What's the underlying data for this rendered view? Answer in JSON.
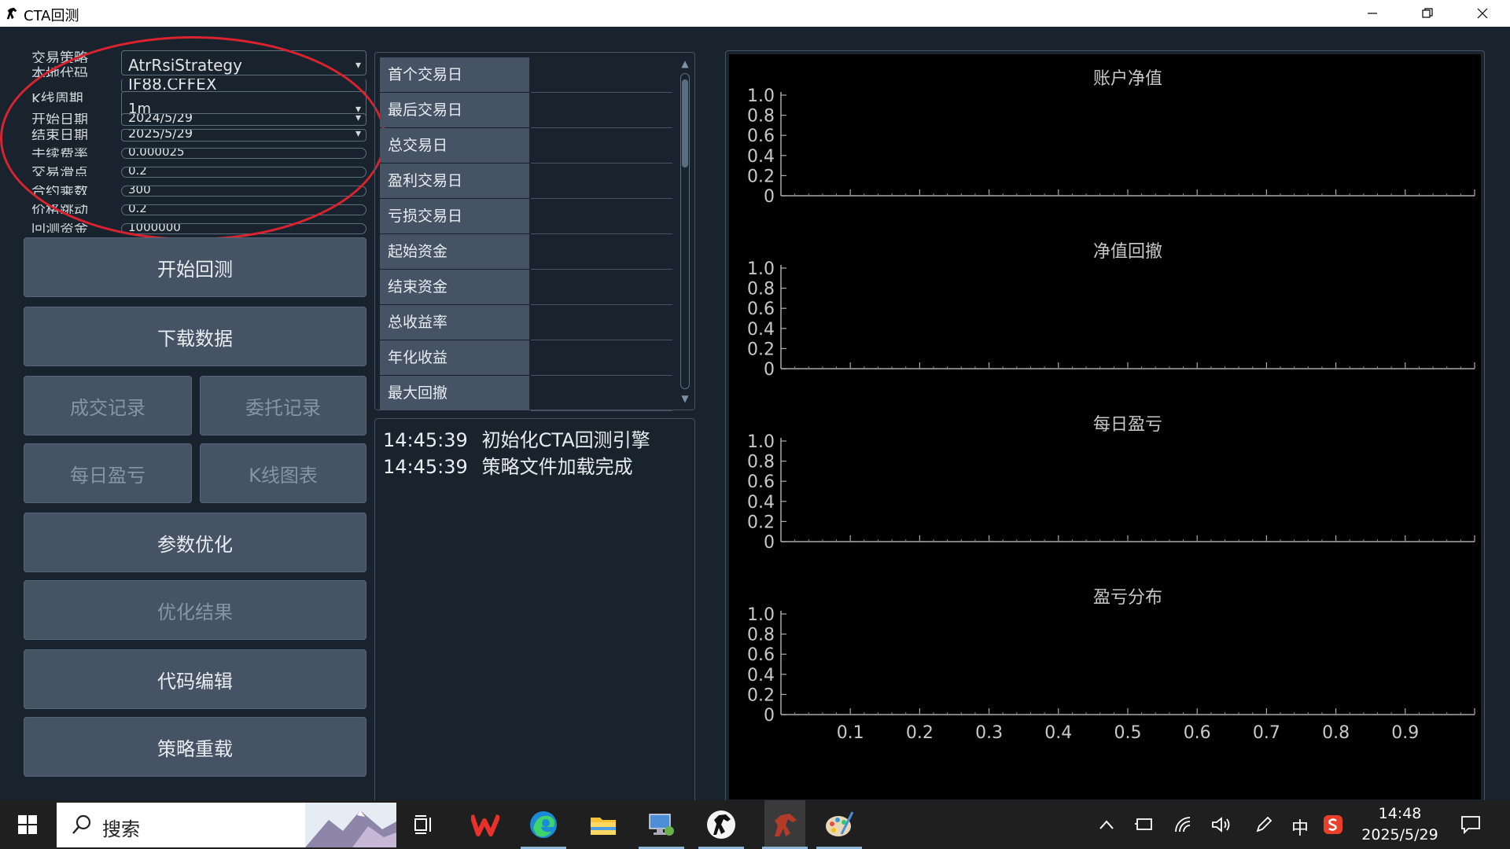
{
  "window": {
    "title": "CTA回测"
  },
  "form": {
    "rows": [
      {
        "label": "交易策略",
        "value": "AtrRsiStrategy",
        "type": "combo"
      },
      {
        "label": "本地代码",
        "value": "IF88.CFFEX",
        "type": "text"
      },
      {
        "label": "K线周期",
        "value": "1m",
        "type": "combo"
      },
      {
        "label": "开始日期",
        "value": "2024/5/29",
        "type": "combo"
      },
      {
        "label": "结束日期",
        "value": "2025/5/29",
        "type": "combo"
      },
      {
        "label": "手续费率",
        "value": "0.000025",
        "type": "text"
      },
      {
        "label": "交易滑点",
        "value": "0.2",
        "type": "text"
      },
      {
        "label": "合约乘数",
        "value": "300",
        "type": "text"
      },
      {
        "label": "价格跳动",
        "value": "0.2",
        "type": "text"
      },
      {
        "label": "回测资金",
        "value": "1000000",
        "type": "text"
      }
    ]
  },
  "buttons": {
    "start_backtest": "开始回测",
    "download_data": "下载数据",
    "trade_records": "成交记录",
    "order_records": "委托记录",
    "daily_pnl": "每日盈亏",
    "kline_chart": "K线图表",
    "param_optimize": "参数优化",
    "optimize_result": "优化结果",
    "code_edit": "代码编辑",
    "strategy_reload": "策略重载"
  },
  "stats": {
    "rows": [
      {
        "label": "首个交易日",
        "value": ""
      },
      {
        "label": "最后交易日",
        "value": ""
      },
      {
        "label": "总交易日",
        "value": ""
      },
      {
        "label": "盈利交易日",
        "value": ""
      },
      {
        "label": "亏损交易日",
        "value": ""
      },
      {
        "label": "起始资金",
        "value": ""
      },
      {
        "label": "结束资金",
        "value": ""
      },
      {
        "label": "总收益率",
        "value": ""
      },
      {
        "label": "年化收益",
        "value": ""
      },
      {
        "label": "最大回撤",
        "value": ""
      }
    ]
  },
  "log": {
    "lines": [
      {
        "time": "14:45:39",
        "msg": "初始化CTA回测引擎"
      },
      {
        "time": "14:45:39",
        "msg": "策略文件加载完成"
      }
    ]
  },
  "chart_data": [
    {
      "type": "line",
      "title": "账户净值",
      "y_ticks": [
        "1.0",
        "0.8",
        "0.6",
        "0.4",
        "0.2",
        "0"
      ],
      "x_ticks": [],
      "series": []
    },
    {
      "type": "line",
      "title": "净值回撤",
      "y_ticks": [
        "1.0",
        "0.8",
        "0.6",
        "0.4",
        "0.2",
        "0"
      ],
      "x_ticks": [],
      "series": []
    },
    {
      "type": "bar",
      "title": "每日盈亏",
      "y_ticks": [
        "1.0",
        "0.8",
        "0.6",
        "0.4",
        "0.2",
        "0"
      ],
      "x_ticks": [],
      "series": []
    },
    {
      "type": "bar",
      "title": "盈亏分布",
      "y_ticks": [
        "1.0",
        "0.8",
        "0.6",
        "0.4",
        "0.2",
        "0"
      ],
      "x_ticks": [
        "0.1",
        "0.2",
        "0.3",
        "0.4",
        "0.5",
        "0.6",
        "0.7",
        "0.8",
        "0.9"
      ],
      "series": []
    }
  ],
  "taskbar": {
    "search_placeholder": "搜索",
    "ime": "中",
    "time": "14:48",
    "date": "2025/5/29"
  },
  "colors": {
    "accent_annotation": "#d9232e",
    "panel": "#455364",
    "background": "#19232d",
    "chart_bg": "#000000"
  }
}
